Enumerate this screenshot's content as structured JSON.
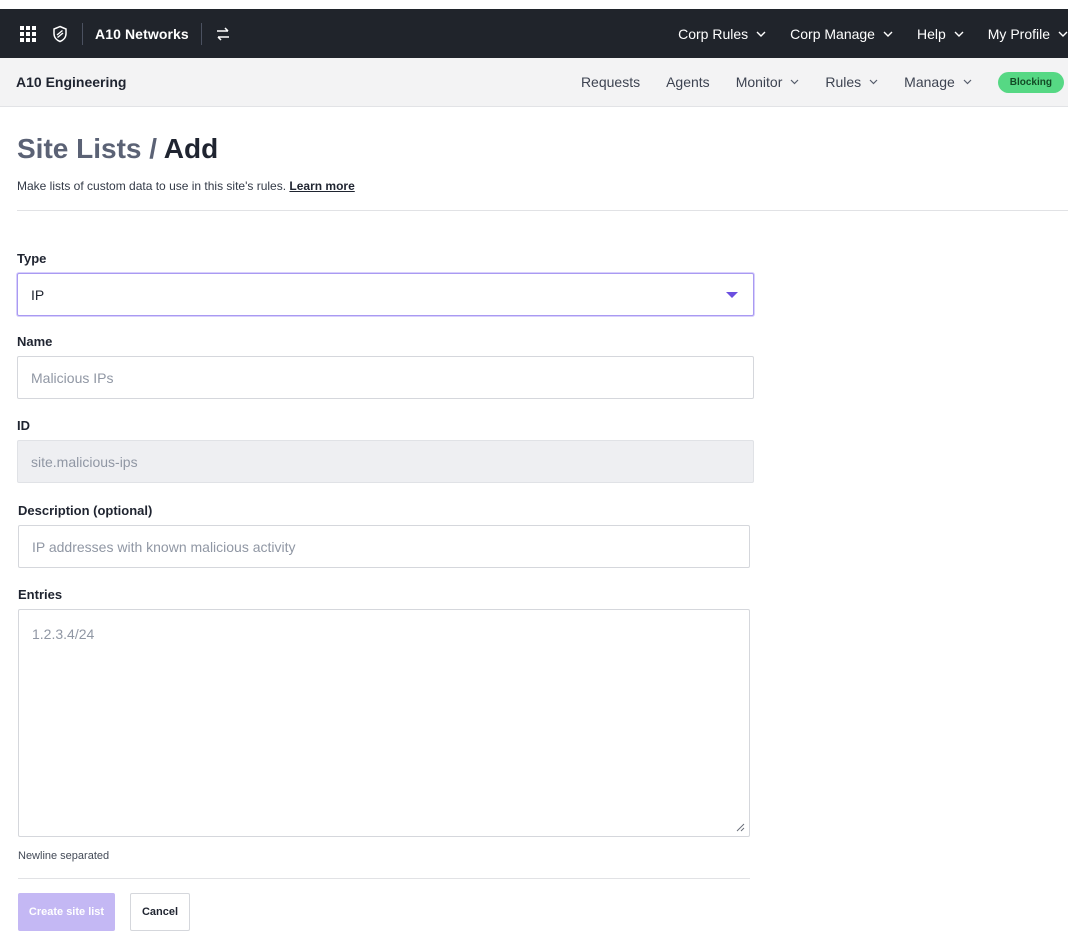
{
  "topbar": {
    "org_name": "A10 Networks",
    "menus": [
      "Corp Rules",
      "Corp Manage",
      "Help",
      "My Profile"
    ],
    "icons": {
      "apps": "grid-icon",
      "logo": "shield-icon",
      "switch": "switch-org-icon"
    }
  },
  "subbar": {
    "site_name": "A10 Engineering",
    "nav": [
      {
        "label": "Requests",
        "dropdown": false
      },
      {
        "label": "Agents",
        "dropdown": false
      },
      {
        "label": "Monitor",
        "dropdown": true
      },
      {
        "label": "Rules",
        "dropdown": true
      },
      {
        "label": "Manage",
        "dropdown": true
      }
    ],
    "status_badge": "Blocking",
    "status_color": "#56d884"
  },
  "page": {
    "title_parent": "Site Lists",
    "title_separator": " / ",
    "title_current": "Add",
    "subtitle": "Make lists of custom data to use in this site's rules. ",
    "learn_more": "Learn more"
  },
  "form": {
    "type_label": "Type",
    "type_value": "IP",
    "name_label": "Name",
    "name_placeholder": "Malicious IPs",
    "id_label": "ID",
    "id_placeholder": "site.malicious-ips",
    "description_label": "Description (optional)",
    "description_placeholder": "IP addresses with known malicious activity",
    "entries_label": "Entries",
    "entries_placeholder": "1.2.3.4/24",
    "entries_hint": "Newline separated"
  },
  "actions": {
    "create_label": "Create site list",
    "cancel_label": "Cancel"
  },
  "colors": {
    "topbar_bg": "#20242b",
    "accent": "#6b4fe0",
    "primary_disabled": "#c4b8f4"
  }
}
